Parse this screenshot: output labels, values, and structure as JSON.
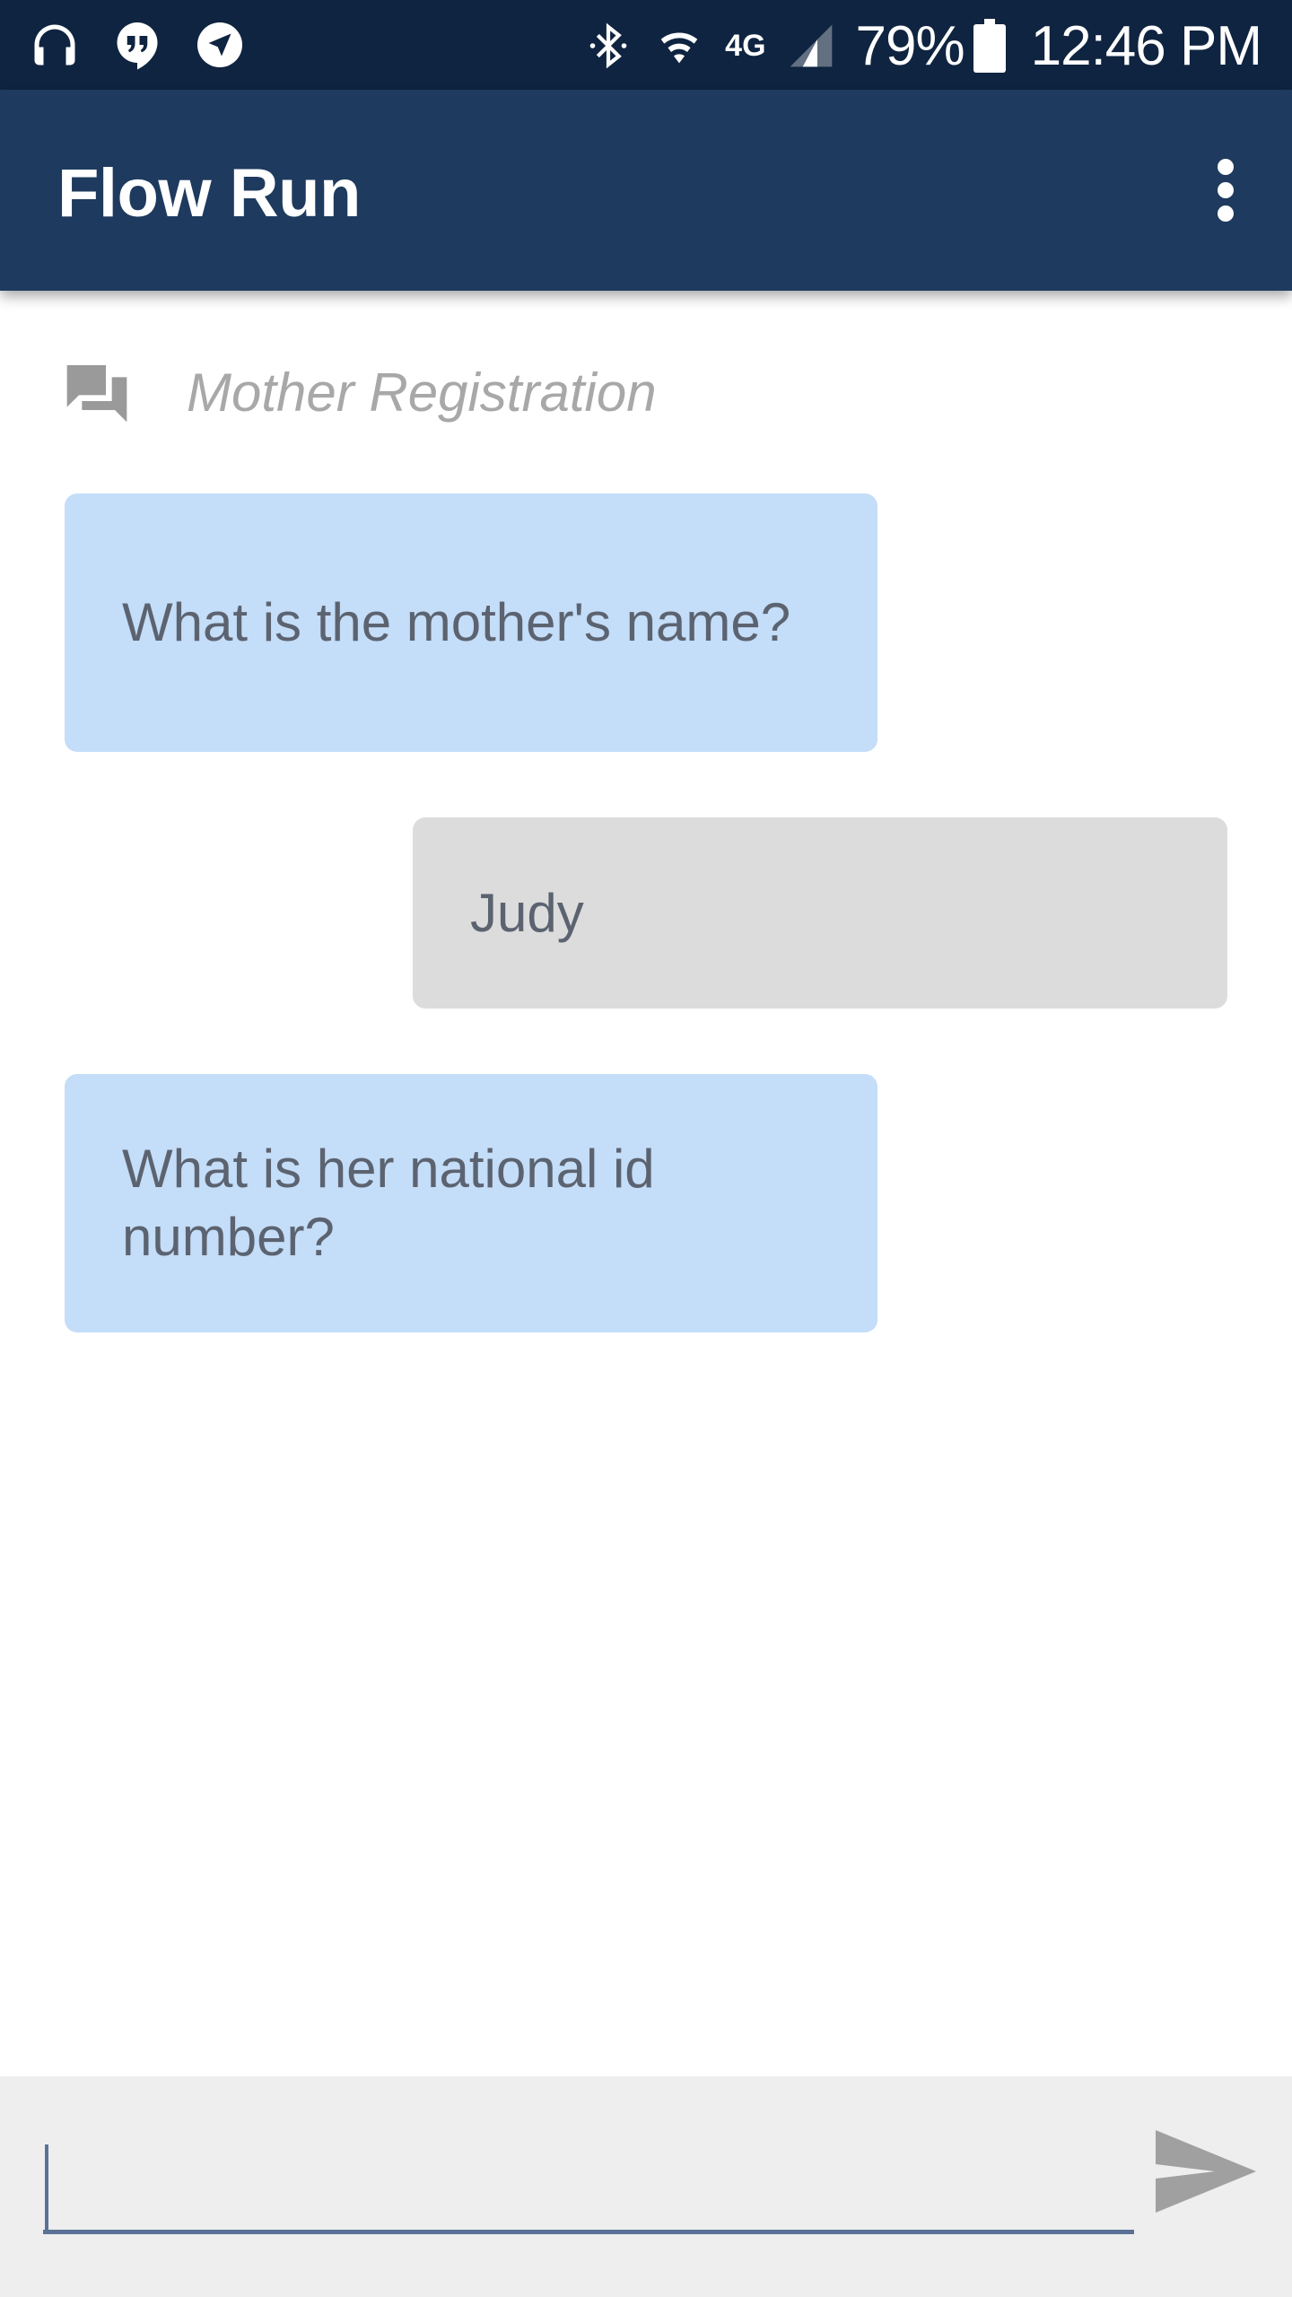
{
  "status_bar": {
    "battery": "79%",
    "time": "12:46 PM",
    "network": "4G",
    "left_icons": [
      "headphones-icon",
      "hangouts-icon",
      "navigation-icon"
    ],
    "right_icons": [
      "bluetooth-icon",
      "wifi-icon",
      "signal-icon",
      "battery-icon"
    ]
  },
  "app_bar": {
    "title": "Flow Run",
    "menu_icon": "more-vert-icon",
    "color": "#1e3a5e"
  },
  "flow": {
    "name": "Mother Registration",
    "icon": "chat-bubbles-icon"
  },
  "messages": [
    {
      "direction": "incoming",
      "text": "What is the mother's name?"
    },
    {
      "direction": "outgoing",
      "text": "Judy"
    },
    {
      "direction": "incoming",
      "text": "What is her national id number?"
    }
  ],
  "composer": {
    "value": "",
    "send_icon": "send-icon"
  },
  "colors": {
    "status_bar": "#0f2440",
    "incoming_bubble": "#c4ddf8",
    "outgoing_bubble": "#dcdcdc",
    "composer_bg": "#eeeeee",
    "input_underline": "#5b7296"
  }
}
